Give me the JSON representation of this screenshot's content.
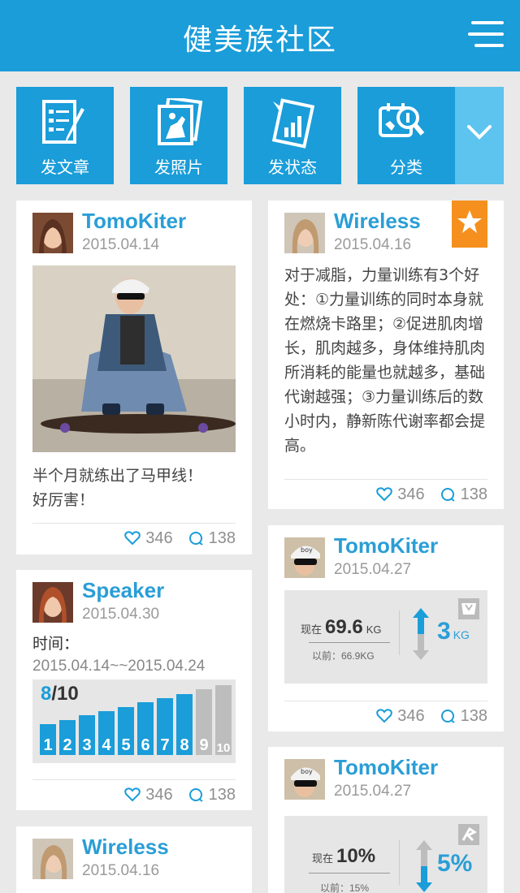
{
  "header": {
    "title": "健美族社区",
    "menu_icon": "hamburger-menu-icon"
  },
  "colors": {
    "primary": "#1a9dd9",
    "light_blue": "#5dc3ef",
    "accent": "#f5901e",
    "name": "#2a9ed6"
  },
  "toolbar": {
    "items": [
      {
        "label": "发文章",
        "icon": "write-article-icon"
      },
      {
        "label": "发照片",
        "icon": "photo-icon"
      },
      {
        "label": "发状态",
        "icon": "status-chart-icon"
      },
      {
        "label": "分类",
        "icon": "category-icon"
      }
    ],
    "dropdown_icon": "chevron-down-icon"
  },
  "posts": [
    {
      "author": "TomoKiter",
      "date": "2015.04.14",
      "caption": "半个月就练出了马甲线！\n好厉害！",
      "likes": "346",
      "comments": "138"
    },
    {
      "author": "Wireless",
      "date": "2015.04.16",
      "text": "对于减脂，力量训练有3个好处：①力量训练的同时本身就在燃烧卡路里；②促进肌肉增长，肌肉越多，身体维持肌肉所消耗的能量也就越多，基础代谢越强；③力量训练后的数小时内，静新陈代谢率都会提高。",
      "likes": "346",
      "comments": "138"
    },
    {
      "author": "Speaker",
      "date": "2015.04.30",
      "time_label": "时间：",
      "time_range": "2015.04.14~~2015.04.24",
      "progress_current": "8",
      "progress_total": "/10",
      "progress_value": 0.8,
      "days": [
        "1",
        "2",
        "3",
        "4",
        "5",
        "6",
        "7",
        "8",
        "9",
        "10"
      ],
      "likes": "346",
      "comments": "138"
    },
    {
      "author": "TomoKiter",
      "date": "2015.04.27",
      "now_label": "现在",
      "now_value": "69.6",
      "now_unit": "KG",
      "before": "以前：66.9KG",
      "diff": "3",
      "diff_unit": "KG",
      "likes": "346",
      "comments": "138"
    },
    {
      "author": "Wireless",
      "date": "2015.04.16"
    },
    {
      "author": "TomoKiter",
      "date": "2015.04.27",
      "now_label": "现在",
      "now_value": "10%",
      "before": "以前：15%",
      "diff": "5%"
    }
  ]
}
